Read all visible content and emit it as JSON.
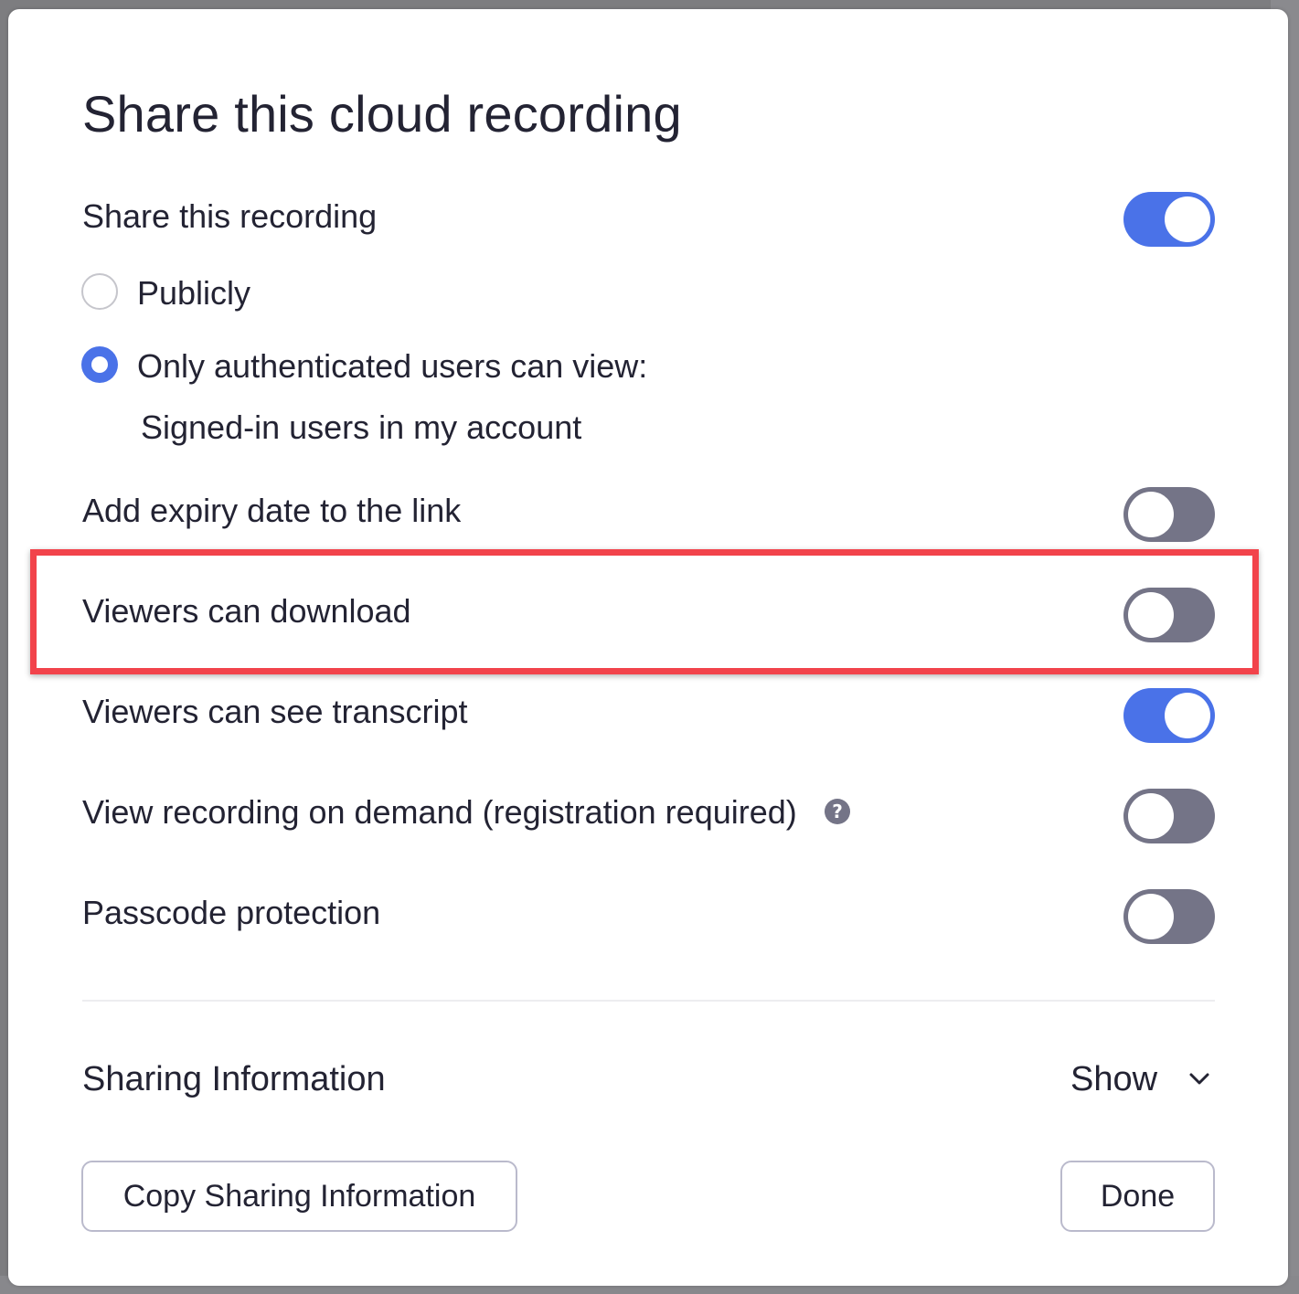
{
  "dialog": {
    "title": "Share this cloud recording",
    "share_recording": {
      "label": "Share this recording",
      "enabled": true
    },
    "access": {
      "options": [
        {
          "label": "Publicly",
          "checked": false
        },
        {
          "label": "Only authenticated users can view:",
          "checked": true
        }
      ],
      "authenticated_scope": "Signed-in users in my account"
    },
    "settings": [
      {
        "label": "Add expiry date to the link",
        "enabled": false
      },
      {
        "label": "Viewers can download",
        "enabled": false,
        "highlighted": true
      },
      {
        "label": "Viewers can see transcript",
        "enabled": true
      },
      {
        "label": "View recording on demand (registration required)",
        "enabled": false,
        "help_icon": "question-circle-icon"
      },
      {
        "label": "Passcode protection",
        "enabled": false
      }
    ],
    "sharing_information": {
      "label": "Sharing Information",
      "toggle_label": "Show",
      "toggle_icon": "chevron-down-icon"
    },
    "buttons": {
      "copy": "Copy Sharing Information",
      "done": "Done"
    }
  },
  "colors": {
    "toggle_on": "#4a72e8",
    "toggle_off": "#747487",
    "highlight": "#f2434b",
    "text": "#232333"
  }
}
